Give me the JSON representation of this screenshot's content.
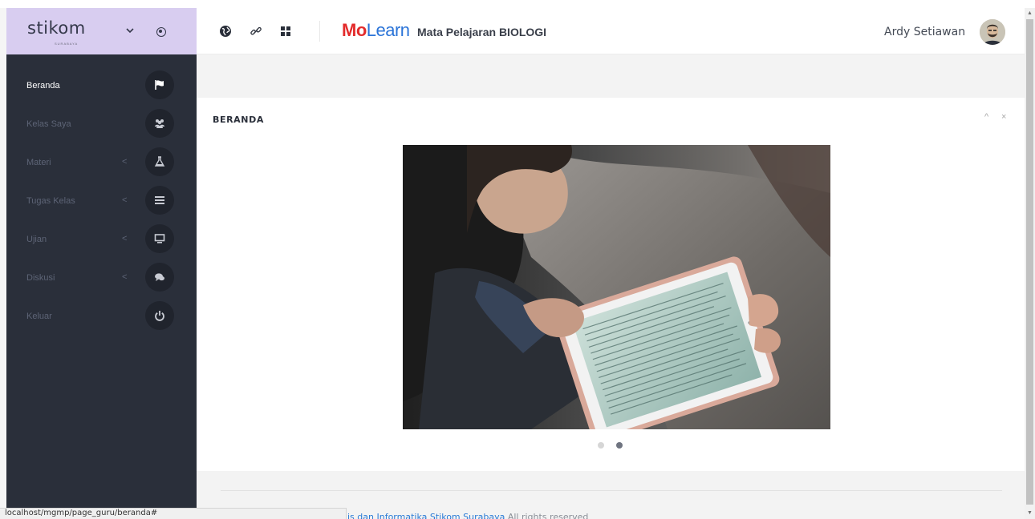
{
  "sidebar": {
    "brand": {
      "logo": "stikom",
      "subtitle": "SURABAYA"
    },
    "items": [
      {
        "label": "Beranda",
        "icon": "flag-icon",
        "has_submenu": false,
        "active": true
      },
      {
        "label": "Kelas Saya",
        "icon": "users-icon",
        "has_submenu": false,
        "active": false
      },
      {
        "label": "Materi",
        "icon": "flask-icon",
        "has_submenu": true,
        "caret": "<",
        "active": false
      },
      {
        "label": "Tugas Kelas",
        "icon": "list-icon",
        "has_submenu": true,
        "caret": "<",
        "active": false
      },
      {
        "label": "Ujian",
        "icon": "desktop-icon",
        "has_submenu": true,
        "caret": "<",
        "active": false
      },
      {
        "label": "Diskusi",
        "icon": "comments-icon",
        "has_submenu": true,
        "caret": "<",
        "active": false
      },
      {
        "label": "Keluar",
        "icon": "power-icon",
        "has_submenu": false,
        "active": false
      }
    ]
  },
  "header": {
    "icons": [
      "globe-icon",
      "link-icon",
      "grid-icon"
    ],
    "app_brand_mo": "Mo",
    "app_brand_learn": "Learn",
    "subject": "Mata Pelajaran BIOLOGI",
    "user_name": "Ardy Setiawan"
  },
  "panel": {
    "title": "BERANDA",
    "collapse": "^",
    "close": "×",
    "carousel": {
      "slides": 2,
      "active_index": 1
    }
  },
  "footer": {
    "text_link": "is dan Informatika Stikom Surabaya",
    "text_rest": "All rights reserved"
  },
  "statusbar": {
    "url": "localhost/mgmp/page_guru/beranda#"
  },
  "colors": {
    "sidebar_bg": "#2a2f3a",
    "brand_bg": "#d8cdf0",
    "mo_red": "#e32b2b",
    "learn_blue": "#2b74d8",
    "footer_link": "#2a7bd6"
  }
}
